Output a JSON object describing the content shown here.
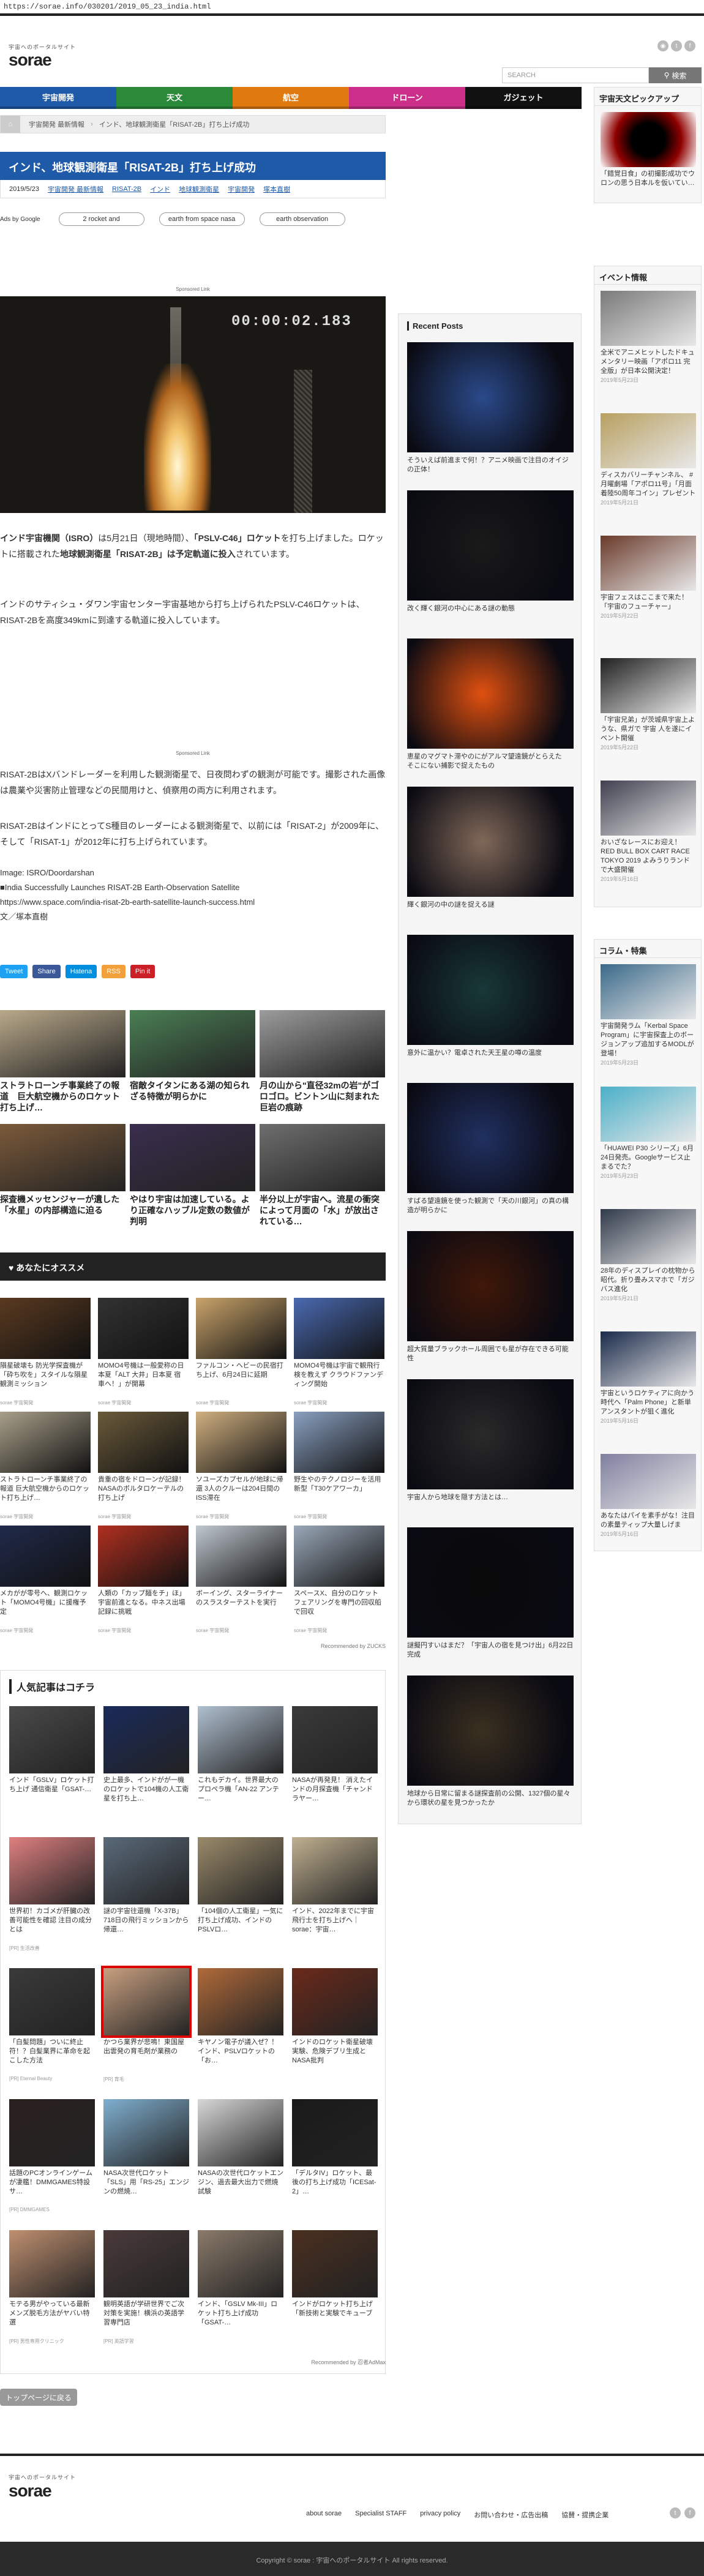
{
  "url": "https://sorae.info/030201/2019_05_23_india.html",
  "header": {
    "tagline": "宇宙へのポータルサイト",
    "logo": "sorae",
    "search_placeholder": "SEARCH",
    "search_button": "検索"
  },
  "social": [
    "rss-icon",
    "twitter-icon",
    "facebook-icon"
  ],
  "nav": [
    {
      "label": "宇宙開発",
      "color": "#1e5aa8"
    },
    {
      "label": "天文",
      "color": "#2a8a3a"
    },
    {
      "label": "航空",
      "color": "#e07a10"
    },
    {
      "label": "ドローン",
      "color": "#cc2f8a"
    },
    {
      "label": "ガジェット",
      "color": "#111111"
    }
  ],
  "breadcrumb": [
    "宇宙開発 最新情報",
    "インド、地球観測衛星「RISAT-2B」打ち上げ成功"
  ],
  "article": {
    "title": "インド、地球観測衛星「RISAT-2B」打ち上げ成功",
    "date": "2019/5/23",
    "tags": [
      "宇宙開発 最新情報",
      "RISAT-2B",
      "インド",
      "地球観測衛星",
      "宇宙開発",
      "塚本直樹"
    ],
    "ads_by": "Ads by Google",
    "ad_pills": [
      "2 rocket and",
      "earth from space nasa",
      "earth observation"
    ],
    "sponsored": "Sponsored Link",
    "video_time": "00:00:02.183",
    "p1_a": "インド宇宙機関（ISRO）",
    "p1_b": "は5月21日（現地時間）、",
    "p1_c": "「PSLV-C46」ロケット",
    "p1_d": "を打ち上げました。ロケットに搭載された",
    "p1_e": "地球観測衛星「RISAT-2B」は予定軌道に投入",
    "p1_f": "されています。",
    "p2": "インドのサティシュ・ダワン宇宙センター宇宙基地から打ち上げられたPSLV-C46ロケットは、RISAT-2Bを高度349kmに到達する軌道に投入しています。",
    "p3": "RISAT-2BはXバンドレーダーを利用した観測衛星で、日夜問わずの観測が可能です。撮影された画像は農業や災害防止管理などの民間用けと、偵察用の両方に利用されます。",
    "p4": "RISAT-2BはインドにとってS種目のレーダーによる観測衛星で、以前には「RISAT-2」が2009年に、そして「RISAT-1」が2012年に打ち上げられています。",
    "credit1": "Image: ISRO/Doordarshan",
    "credit2": "■India Successfully Launches RISAT-2B Earth-Observation Satellite",
    "credit3": "https://www.space.com/india-risat-2b-earth-satellite-launch-success.html",
    "credit4": "文／塚本直樹"
  },
  "share": [
    {
      "label": "Tweet",
      "color": "#1da1f2"
    },
    {
      "label": "Share",
      "color": "#3b5998"
    },
    {
      "label": "Hatena",
      "color": "#008fde"
    },
    {
      "label": "RSS",
      "color": "#f2a03c"
    },
    {
      "label": "Pin it",
      "color": "#cb2027"
    }
  ],
  "related": [
    {
      "text": "ストラトローンチ事業終了の報道　巨大航空機からのロケット打ち上げ…",
      "color": "#b9a98a"
    },
    {
      "text": "宿敵タイタンにある湖の知られざる特徴が明らかに",
      "color": "#4a7f54"
    },
    {
      "text": "月の山から\"直径32mの岩\"がゴロゴロ。ビントン山に刻まれた巨岩の痕跡",
      "color": "#9c9c9c"
    },
    {
      "text": "探査機メッセンジャーが遺した「水星」の内部構造に迫る",
      "color": "#7b5a3a"
    },
    {
      "text": "やはり宇宙は加速している。より正確なハッブル定数の数値が判明",
      "color": "#3a2e4e"
    },
    {
      "text": "半分以上が宇宙へ。流星の衝突によって月面の「水」が放出されている…",
      "color": "#6e6e6e"
    }
  ],
  "osusume": {
    "heading": "あなたにオススメ",
    "source": "sorae 宇宙開発",
    "recommended": "Recommended by ZUCKS"
  },
  "osusume_tiles": [
    {
      "text": "隕星破壊も 防光学探査機が「砕ち吹を」スタイルな隕星観測ミッション",
      "color": "#5a3a20"
    },
    {
      "text": "MOMO4号機は一般愛称の日本夏「ALT 大井」日本夏 宿 車へ！」が開幕",
      "color": "#323232"
    },
    {
      "text": "ファルコン・ヘビーの民宿打ち上げ、6月24日に延期",
      "color": "#c9a46a"
    },
    {
      "text": "MOMO4号機は宇宙で観飛行検を教えず クラウドファンディング開始",
      "color": "#4a6ab0"
    },
    {
      "text": "ストラトローンチ事業終了の報道 巨大航空機からのロケット打ち上げ…",
      "color": "#a9a08a"
    },
    {
      "text": "貴重の宿をドローンが記録！NASAのボルタロケーテルの打ち上げ",
      "color": "#6a5a3a"
    },
    {
      "text": "ソユーズカプセルが地球に帰還 3人のクルーは204日間のISS滞在",
      "color": "#d0b080"
    },
    {
      "text": "野生やのテクノロジーを活用 新型「T30ケアワーカ」",
      "color": "#8aa0c0"
    },
    {
      "text": "メカがが零号へ、観測ロケット「MOMO4号機」に援権予定",
      "color": "#202a4a"
    },
    {
      "text": "人類の「カップ麺をチ」ほ」宇宙前進となる。中ネス出場記録に挑戦",
      "color": "#b03020"
    },
    {
      "text": "ボーイング、スターライナーのスラスターテストを実行",
      "color": "#c0c8d0"
    },
    {
      "text": "スペースX、自分のロケットフェアリングを専門の回収船で回収",
      "color": "#9aa8b8"
    }
  ],
  "popular": {
    "heading": "人気記事はコチラ",
    "recommended": "Recommended by 忍者AdMax"
  },
  "popular_tiles": [
    {
      "text": "インド「GSLV」ロケット打ち上げ 通信衛星「GSAT-…",
      "color": "#4a4a4a",
      "src": ""
    },
    {
      "text": "史上最多、インドがが一機のロケットで104機の人工衛星を打ち上…",
      "color": "#1a2a5a",
      "src": ""
    },
    {
      "text": "これもデカイ。世界最大のプロペラ機「AN-22 アンテー…",
      "color": "#b0c0d0",
      "src": ""
    },
    {
      "text": "NASAが再発見！ 消えたインドの月探査機「チャンドラヤー…",
      "color": "#3a3a3a",
      "src": ""
    },
    {
      "text": "世界初！カゴメが肝臓の改善可能性を確認 注目の成分とは",
      "color": "#e08080",
      "src": "[PR] 生活改善"
    },
    {
      "text": "謎の宇宙往還機「X-37B」718日の飛行ミッションから帰還…",
      "color": "#5a6a7a",
      "src": ""
    },
    {
      "text": "「104個の人工衛星」一気に打ち上げ成功、インドのPSLVロ…",
      "color": "#9a8a6a",
      "src": ""
    },
    {
      "text": "インド、2022年までに宇宙飛行士を打ち上げへ｜sorae：宇宙…",
      "color": "#c0b090",
      "src": ""
    },
    {
      "text": "「白髪問題」ついに終止符！？白髪業界に革命を起こした方法",
      "color": "#3a3a3a",
      "src": "[PR] Eternal Beauty"
    },
    {
      "text": "かつら業界が悲鳴！東国屋出雲発の育毛剤が業務の",
      "color": "#c8a080",
      "src": "[PR] 育毛"
    },
    {
      "text": "キヤノン電子が議入ぜ？！インド、PSLVロケットの「お…",
      "color": "#b06a3a",
      "src": ""
    },
    {
      "text": "インドのロケット衛星破壊実験、危険デブリ生成とNASA批判",
      "color": "#6a2a1a",
      "src": ""
    },
    {
      "text": "話題のPCオンラインゲームが凄艦！DMMGAMES特設サ…",
      "color": "#2a2020",
      "src": "[PR] DMMGAMES"
    },
    {
      "text": "NASA次世代ロケット「SLS」用「RS-25」エンジンの燃焼…",
      "color": "#80b0d0",
      "src": ""
    },
    {
      "text": "NASAの次世代ロケットエンジン、過去最大出力で燃焼試験",
      "color": "#d8d8d8",
      "src": ""
    },
    {
      "text": "「デルタIV」ロケット、最後の打ち上げ成功「ICESat-2」…",
      "color": "#1a1a1a",
      "src": ""
    },
    {
      "text": "モテる男がやっている最新メンズ脱毛方法がヤバい特選",
      "color": "#c09070",
      "src": "[PR] 男性専用クリニック"
    },
    {
      "text": "観明英語が学研世界でご次対策を実施！横浜の英語学習専門店",
      "color": "#4a3a3a",
      "src": "[PR] 英語学習"
    },
    {
      "text": "インド、「GSLV Mk-III」ロケット打ち上げ成功 「GSAT-…",
      "color": "#8a7a6a",
      "src": ""
    },
    {
      "text": "インドがロケット打ち上げ「新技術と実験でキューブ",
      "color": "#4a3020",
      "src": ""
    }
  ],
  "page_top": "トップページに戻る",
  "recent": {
    "heading": "Recent Posts",
    "posts": [
      {
        "text": "そういえば前進まで何！？アニメ映画で注目のオイジの正体！",
        "color": "#2a4a8a"
      },
      {
        "text": "改く輝く銀河の中心にある謎の動態",
        "color": "#1a1a1a"
      },
      {
        "text": "恵星のマグマト滞やのにがアルマ望遠鏡がとらえた　そこにない捕影で捉えたもの",
        "color": "#e05010"
      },
      {
        "text": "輝く銀河の中の謎を捉える謎",
        "color": "#806858"
      },
      {
        "text": "意外に温かい？電卓された天王星の噂の温度",
        "color": "#183838"
      },
      {
        "text": "すばる望遠鏡を使った観測で「天の川銀河」の真の構造が明らかに",
        "color": "#203060"
      },
      {
        "text": "超大質量ブラックホール周囲でも星が存在できる可能性",
        "color": "#401808"
      },
      {
        "text": "宇宙人から地球を隠す方法とは…",
        "color": "#2a2a2a"
      },
      {
        "text": "謎擬円すいはまだ？「宇宙人の宿を見つけ出」6月22日完成",
        "color": "#0a0a0a"
      },
      {
        "text": "地球から日常に留まる謎探査前の公開、1327個の星々から環状の星を見つかったか",
        "color": "#3a3020"
      }
    ]
  },
  "sidebar": {
    "pickup_heading": "宇宙天文ピックアップ",
    "pickup": {
      "text": "「錯覚日食」の初撮影成功でウロンの思う日本ルを仮いてい…",
      "color": "#900000"
    },
    "events_heading": "イベント情報",
    "events": [
      {
        "text": "全米でアニメヒットしたドキュメンタリー映画「アポロ11 完全版」が日本公開決定！",
        "date": "2019年5月23日",
        "color": "#7a7a7a"
      },
      {
        "text": "ディスカバリーチャンネル、 #月曜劇場「アポロ11号」「月面着陸50周年コイン」プレゼント",
        "date": "2019年5月21日",
        "color": "#b8a060"
      },
      {
        "text": "宇宙フェスはここまで来た！「宇宙のフューチャー」",
        "date": "2019年5月22日",
        "color": "#6a3a2a"
      },
      {
        "text": "「宇宙兄弟」が茨城県宇宙上ような、県ガで 宇宙 人を遂にイベント開催",
        "date": "2019年5月22日",
        "color": "#202020"
      },
      {
        "text": "おいざなレースにお迎え！ RED BULL BOX CART RACE TOKYO 2019 よみうりランドで大盛開催",
        "date": "2019年5月16日",
        "color": "#404050"
      }
    ],
    "column_heading": "コラム・特集",
    "columns": [
      {
        "text": "宇宙開発ラム「Kerbal Space Program」に宇宙探査上のボージョンアップ追加するMODLが登場！",
        "date": "2019年5月23日",
        "color": "#3a6a8a"
      },
      {
        "text": "「HUAWEI P30 シリーズ」6月24日発売。Googleサービス止まるでた？",
        "date": "2019年5月23日",
        "color": "#4ab0c8"
      },
      {
        "text": "28年のディスプレイの枕物から昭代。折り畳みスマホで「ガジバス進化",
        "date": "2019年5月21日",
        "color": "#303a4a"
      },
      {
        "text": "宇宙というロケティアに向かう時代へ「Palm Phone」と新単アンスタントが狙く進化",
        "date": "2019年5月16日",
        "color": "#1a2a4a"
      },
      {
        "text": "あなたはパイを素手がな！注目の素量ティップ大量しげま",
        "date": "2019年5月16日",
        "color": "#8080a0"
      }
    ]
  },
  "footer": {
    "tagline": "宇宙へのポータルサイト",
    "logo": "sorae",
    "links": [
      "about sorae",
      "Specialist STAFF",
      "privacy policy",
      "お問い合わせ・広告出稿",
      "協賛・提携企業"
    ],
    "copyright": "Copyright ©  sorae : 宇宙へのポータルサイト All rights reserved."
  }
}
